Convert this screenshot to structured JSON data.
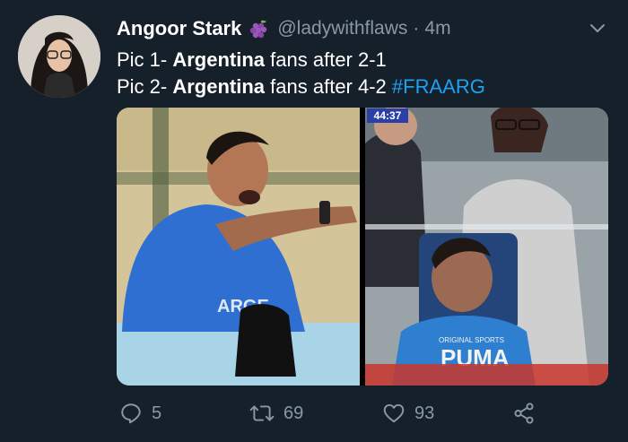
{
  "tweet": {
    "author": {
      "display_name": "Angoor Stark",
      "handle": "@ladywithflaws",
      "avatar_icon": "profile-avatar",
      "name_emoji": "grapes-icon"
    },
    "time_separator": "·",
    "time_ago": "4m",
    "text": {
      "line1_prefix": "Pic 1- ",
      "line1_bold": "Argentina",
      "line1_suffix": " fans after 2-1",
      "line2_prefix": "Pic 2- ",
      "line2_bold": "Argentina",
      "line2_suffix": " fans after 4-2 ",
      "hashtag": "#FRAARG"
    },
    "media": {
      "photo_count": 2,
      "clock_badge": "44:37",
      "photo1_shirt_text": "ARGE",
      "photo2_shirt_text": "PUMA",
      "photo2_shirt_subtext": "ORIGINAL SPORTS"
    },
    "actions": {
      "reply_count": "5",
      "retweet_count": "69",
      "like_count": "93"
    }
  },
  "colors": {
    "background": "#15202b",
    "text": "#ffffff",
    "secondary": "#8899a6",
    "link": "#1da1f2"
  }
}
